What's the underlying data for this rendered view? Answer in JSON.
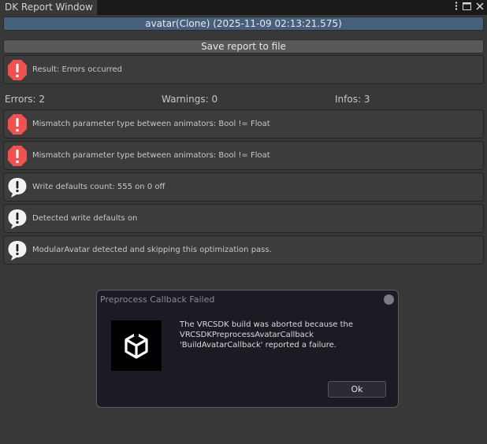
{
  "window": {
    "tab_title": "DK Report Window",
    "menu_icon": "kebab-menu-icon",
    "maximize_icon": "maximize-icon",
    "close_icon": "close-icon"
  },
  "avatar_field": {
    "value": "avatar(Clone) (2025-11-09 02:13:21.575)"
  },
  "save_button": {
    "label": "Save report to file"
  },
  "result": {
    "text": "Result: Errors occurred",
    "icon": "error-icon",
    "color": "#f0524f"
  },
  "counts": {
    "errors": "Errors: 2",
    "warnings": "Warnings: 0",
    "infos": "Infos: 3"
  },
  "messages": [
    {
      "type": "error",
      "icon": "error-icon",
      "text": "Mismatch parameter type between animators: Bool != Float"
    },
    {
      "type": "error",
      "icon": "error-icon",
      "text": "Mismatch parameter type between animators: Bool != Float"
    },
    {
      "type": "info",
      "icon": "info-icon",
      "text": "Write defaults count: 555 on 0 off"
    },
    {
      "type": "info",
      "icon": "info-icon",
      "text": "Detected write defaults on"
    },
    {
      "type": "info",
      "icon": "info-icon",
      "text": "ModularAvatar detected and skipping this optimization pass."
    }
  ],
  "dialog": {
    "title": "Preprocess Callback Failed",
    "message_lines": [
      "The VRCSDK build was aborted because the",
      "VRCSDKPreprocessAvatarCallback",
      "'BuildAvatarCallback' reported a failure."
    ],
    "ok_label": "Ok",
    "logo_icon": "unity-logo-icon"
  }
}
